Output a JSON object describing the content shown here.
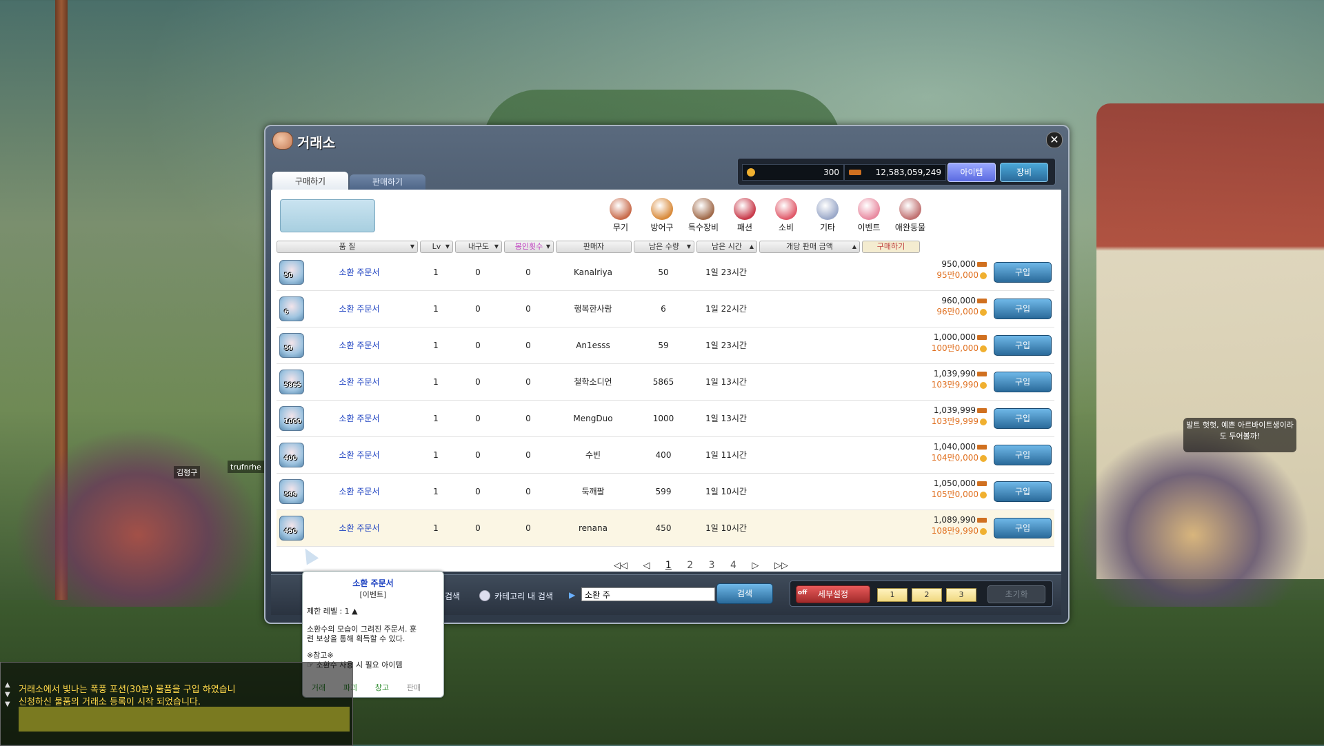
{
  "window": {
    "title": "거래소",
    "close": "✕"
  },
  "tabs": {
    "buy": "구매하기",
    "sell": "판매하기"
  },
  "currency": {
    "maple_points": "300",
    "meso": "12,583,059,249",
    "item_mode": "아이템",
    "equip_mode": "장비"
  },
  "categories": [
    {
      "label": "무기",
      "color": "#c86a4a"
    },
    {
      "label": "방어구",
      "color": "#d88a3a"
    },
    {
      "label": "특수장비",
      "color": "#a06a4a"
    },
    {
      "label": "패션",
      "color": "#c83a4a"
    },
    {
      "label": "소비",
      "color": "#e05a6a"
    },
    {
      "label": "기타",
      "color": "#9aa8c8"
    },
    {
      "label": "이벤트",
      "color": "#e88aa0"
    },
    {
      "label": "애완동물",
      "color": "#c07070"
    }
  ],
  "columns": {
    "quality": "품 질",
    "lv": "Lv",
    "durability": "내구도",
    "seal_count": "봉인횟수",
    "seller": "판매자",
    "remaining_qty": "남은 수량",
    "remaining_time": "남은 시간",
    "unit_price": "개당 판매 금액",
    "buy": "구매하기"
  },
  "rows": [
    {
      "qty": "50",
      "name": "소환 주문서",
      "lv": "1",
      "dur": "0",
      "seal": "0",
      "seller": "Kanalriya",
      "remain": "50",
      "time": "1일 23시간",
      "meso": "950,000",
      "maple": "95만0,000",
      "buy": "구입"
    },
    {
      "qty": "6",
      "name": "소환 주문서",
      "lv": "1",
      "dur": "0",
      "seal": "0",
      "seller": "행복한사람",
      "remain": "6",
      "time": "1일 22시간",
      "meso": "960,000",
      "maple": "96만0,000",
      "buy": "구입"
    },
    {
      "qty": "59",
      "name": "소환 주문서",
      "lv": "1",
      "dur": "0",
      "seal": "0",
      "seller": "An1esss",
      "remain": "59",
      "time": "1일 23시간",
      "meso": "1,000,000",
      "maple": "100만0,000",
      "buy": "구입"
    },
    {
      "qty": "5865",
      "name": "소환 주문서",
      "lv": "1",
      "dur": "0",
      "seal": "0",
      "seller": "철학소디언",
      "remain": "5865",
      "time": "1일 13시간",
      "meso": "1,039,990",
      "maple": "103만9,990",
      "buy": "구입"
    },
    {
      "qty": "1000",
      "name": "소환 주문서",
      "lv": "1",
      "dur": "0",
      "seal": "0",
      "seller": "MengDuo",
      "remain": "1000",
      "time": "1일 13시간",
      "meso": "1,039,999",
      "maple": "103만9,999",
      "buy": "구입"
    },
    {
      "qty": "400",
      "name": "소환 주문서",
      "lv": "1",
      "dur": "0",
      "seal": "0",
      "seller": "수빈",
      "remain": "400",
      "time": "1일 11시간",
      "meso": "1,040,000",
      "maple": "104만0,000",
      "buy": "구입"
    },
    {
      "qty": "599",
      "name": "소환 주문서",
      "lv": "1",
      "dur": "0",
      "seal": "0",
      "seller": "둑깨팔",
      "remain": "599",
      "time": "1일 10시간",
      "meso": "1,050,000",
      "maple": "105만0,000",
      "buy": "구입"
    },
    {
      "qty": "450",
      "name": "소환 주문서",
      "lv": "1",
      "dur": "0",
      "seal": "0",
      "seller": "renana",
      "remain": "450",
      "time": "1일 10시간",
      "meso": "1,089,990",
      "maple": "108만9,990",
      "buy": "구입"
    }
  ],
  "pager": {
    "first": "◁◁",
    "prev": "◁",
    "pages": [
      "1",
      "2",
      "3",
      "4"
    ],
    "next": "▷",
    "last": "▷▷"
  },
  "bottom": {
    "search_label": "검색",
    "category_search": "카테고리 내 검색",
    "search_value": "소환 주",
    "search_button": "검색",
    "advanced": "세부설정",
    "off": "off",
    "presets": [
      "1",
      "2",
      "3"
    ],
    "reset": "초기화"
  },
  "tooltip": {
    "title": "소환 주문서",
    "subtitle": "[이벤트]",
    "level": "제한 레벨 : 1 ▲",
    "desc1": "소환수의 모습이 그려진 주문서. 훈",
    "desc2": "련 보상을 통해 획득할 수 있다.",
    "note": "※참고※",
    "note2": "☞ 소환수 사용 시 필요 아이템",
    "actions": [
      "거래",
      "파괴",
      "창고",
      "판매"
    ]
  },
  "chat": {
    "line1": "거래소에서 빛나는 폭풍 포션(30분) 물품을 구입 하였습니",
    "line2": "신청하신 물품의 거래소 등록이 시작 되었습니다."
  },
  "world": {
    "tag1": "김형구",
    "tag2": "trufnrhe [별내]",
    "npc": "발트 헛헛, 예쁜 아르바이트생이라도 두어볼까!"
  }
}
